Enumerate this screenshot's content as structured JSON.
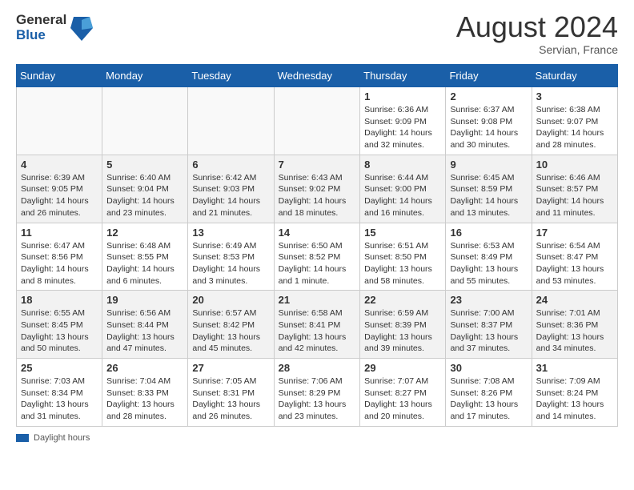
{
  "header": {
    "logo_line1": "General",
    "logo_line2": "Blue",
    "month_year": "August 2024",
    "location": "Servian, France"
  },
  "weekdays": [
    "Sunday",
    "Monday",
    "Tuesday",
    "Wednesday",
    "Thursday",
    "Friday",
    "Saturday"
  ],
  "legend": {
    "label": "Daylight hours"
  },
  "weeks": [
    [
      {
        "day": "",
        "sunrise": "",
        "sunset": "",
        "daylight": ""
      },
      {
        "day": "",
        "sunrise": "",
        "sunset": "",
        "daylight": ""
      },
      {
        "day": "",
        "sunrise": "",
        "sunset": "",
        "daylight": ""
      },
      {
        "day": "",
        "sunrise": "",
        "sunset": "",
        "daylight": ""
      },
      {
        "day": "1",
        "sunrise": "Sunrise: 6:36 AM",
        "sunset": "Sunset: 9:09 PM",
        "daylight": "Daylight: 14 hours and 32 minutes."
      },
      {
        "day": "2",
        "sunrise": "Sunrise: 6:37 AM",
        "sunset": "Sunset: 9:08 PM",
        "daylight": "Daylight: 14 hours and 30 minutes."
      },
      {
        "day": "3",
        "sunrise": "Sunrise: 6:38 AM",
        "sunset": "Sunset: 9:07 PM",
        "daylight": "Daylight: 14 hours and 28 minutes."
      }
    ],
    [
      {
        "day": "4",
        "sunrise": "Sunrise: 6:39 AM",
        "sunset": "Sunset: 9:05 PM",
        "daylight": "Daylight: 14 hours and 26 minutes."
      },
      {
        "day": "5",
        "sunrise": "Sunrise: 6:40 AM",
        "sunset": "Sunset: 9:04 PM",
        "daylight": "Daylight: 14 hours and 23 minutes."
      },
      {
        "day": "6",
        "sunrise": "Sunrise: 6:42 AM",
        "sunset": "Sunset: 9:03 PM",
        "daylight": "Daylight: 14 hours and 21 minutes."
      },
      {
        "day": "7",
        "sunrise": "Sunrise: 6:43 AM",
        "sunset": "Sunset: 9:02 PM",
        "daylight": "Daylight: 14 hours and 18 minutes."
      },
      {
        "day": "8",
        "sunrise": "Sunrise: 6:44 AM",
        "sunset": "Sunset: 9:00 PM",
        "daylight": "Daylight: 14 hours and 16 minutes."
      },
      {
        "day": "9",
        "sunrise": "Sunrise: 6:45 AM",
        "sunset": "Sunset: 8:59 PM",
        "daylight": "Daylight: 14 hours and 13 minutes."
      },
      {
        "day": "10",
        "sunrise": "Sunrise: 6:46 AM",
        "sunset": "Sunset: 8:57 PM",
        "daylight": "Daylight: 14 hours and 11 minutes."
      }
    ],
    [
      {
        "day": "11",
        "sunrise": "Sunrise: 6:47 AM",
        "sunset": "Sunset: 8:56 PM",
        "daylight": "Daylight: 14 hours and 8 minutes."
      },
      {
        "day": "12",
        "sunrise": "Sunrise: 6:48 AM",
        "sunset": "Sunset: 8:55 PM",
        "daylight": "Daylight: 14 hours and 6 minutes."
      },
      {
        "day": "13",
        "sunrise": "Sunrise: 6:49 AM",
        "sunset": "Sunset: 8:53 PM",
        "daylight": "Daylight: 14 hours and 3 minutes."
      },
      {
        "day": "14",
        "sunrise": "Sunrise: 6:50 AM",
        "sunset": "Sunset: 8:52 PM",
        "daylight": "Daylight: 14 hours and 1 minute."
      },
      {
        "day": "15",
        "sunrise": "Sunrise: 6:51 AM",
        "sunset": "Sunset: 8:50 PM",
        "daylight": "Daylight: 13 hours and 58 minutes."
      },
      {
        "day": "16",
        "sunrise": "Sunrise: 6:53 AM",
        "sunset": "Sunset: 8:49 PM",
        "daylight": "Daylight: 13 hours and 55 minutes."
      },
      {
        "day": "17",
        "sunrise": "Sunrise: 6:54 AM",
        "sunset": "Sunset: 8:47 PM",
        "daylight": "Daylight: 13 hours and 53 minutes."
      }
    ],
    [
      {
        "day": "18",
        "sunrise": "Sunrise: 6:55 AM",
        "sunset": "Sunset: 8:45 PM",
        "daylight": "Daylight: 13 hours and 50 minutes."
      },
      {
        "day": "19",
        "sunrise": "Sunrise: 6:56 AM",
        "sunset": "Sunset: 8:44 PM",
        "daylight": "Daylight: 13 hours and 47 minutes."
      },
      {
        "day": "20",
        "sunrise": "Sunrise: 6:57 AM",
        "sunset": "Sunset: 8:42 PM",
        "daylight": "Daylight: 13 hours and 45 minutes."
      },
      {
        "day": "21",
        "sunrise": "Sunrise: 6:58 AM",
        "sunset": "Sunset: 8:41 PM",
        "daylight": "Daylight: 13 hours and 42 minutes."
      },
      {
        "day": "22",
        "sunrise": "Sunrise: 6:59 AM",
        "sunset": "Sunset: 8:39 PM",
        "daylight": "Daylight: 13 hours and 39 minutes."
      },
      {
        "day": "23",
        "sunrise": "Sunrise: 7:00 AM",
        "sunset": "Sunset: 8:37 PM",
        "daylight": "Daylight: 13 hours and 37 minutes."
      },
      {
        "day": "24",
        "sunrise": "Sunrise: 7:01 AM",
        "sunset": "Sunset: 8:36 PM",
        "daylight": "Daylight: 13 hours and 34 minutes."
      }
    ],
    [
      {
        "day": "25",
        "sunrise": "Sunrise: 7:03 AM",
        "sunset": "Sunset: 8:34 PM",
        "daylight": "Daylight: 13 hours and 31 minutes."
      },
      {
        "day": "26",
        "sunrise": "Sunrise: 7:04 AM",
        "sunset": "Sunset: 8:33 PM",
        "daylight": "Daylight: 13 hours and 28 minutes."
      },
      {
        "day": "27",
        "sunrise": "Sunrise: 7:05 AM",
        "sunset": "Sunset: 8:31 PM",
        "daylight": "Daylight: 13 hours and 26 minutes."
      },
      {
        "day": "28",
        "sunrise": "Sunrise: 7:06 AM",
        "sunset": "Sunset: 8:29 PM",
        "daylight": "Daylight: 13 hours and 23 minutes."
      },
      {
        "day": "29",
        "sunrise": "Sunrise: 7:07 AM",
        "sunset": "Sunset: 8:27 PM",
        "daylight": "Daylight: 13 hours and 20 minutes."
      },
      {
        "day": "30",
        "sunrise": "Sunrise: 7:08 AM",
        "sunset": "Sunset: 8:26 PM",
        "daylight": "Daylight: 13 hours and 17 minutes."
      },
      {
        "day": "31",
        "sunrise": "Sunrise: 7:09 AM",
        "sunset": "Sunset: 8:24 PM",
        "daylight": "Daylight: 13 hours and 14 minutes."
      }
    ]
  ]
}
